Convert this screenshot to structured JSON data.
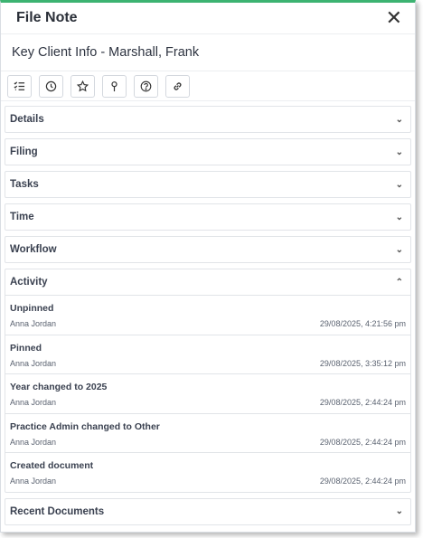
{
  "window": {
    "title": "File Note"
  },
  "subtitle": "Key Client Info - Marshall, Frank",
  "toolbar": {
    "buttons": [
      {
        "icon": "checklist-icon"
      },
      {
        "icon": "clock-icon"
      },
      {
        "icon": "star-icon"
      },
      {
        "icon": "pin-icon"
      },
      {
        "icon": "question-icon"
      },
      {
        "icon": "link-icon"
      }
    ]
  },
  "sections": {
    "details": "Details",
    "filing": "Filing",
    "tasks": "Tasks",
    "time": "Time",
    "workflow": "Workflow",
    "activity": "Activity",
    "recent_documents": "Recent Documents"
  },
  "activity": [
    {
      "title": "Unpinned",
      "user": "Anna Jordan",
      "time": "29/08/2025, 4:21:56 pm"
    },
    {
      "title": "Pinned",
      "user": "Anna Jordan",
      "time": "29/08/2025, 3:35:12 pm"
    },
    {
      "title": "Year changed to 2025",
      "user": "Anna Jordan",
      "time": "29/08/2025, 2:44:24 pm"
    },
    {
      "title": "Practice Admin changed to Other",
      "user": "Anna Jordan",
      "time": "29/08/2025, 2:44:24 pm"
    },
    {
      "title": "Created document",
      "user": "Anna Jordan",
      "time": "29/08/2025, 2:44:24 pm"
    }
  ],
  "colors": {
    "accent_border": "#3cb371"
  }
}
